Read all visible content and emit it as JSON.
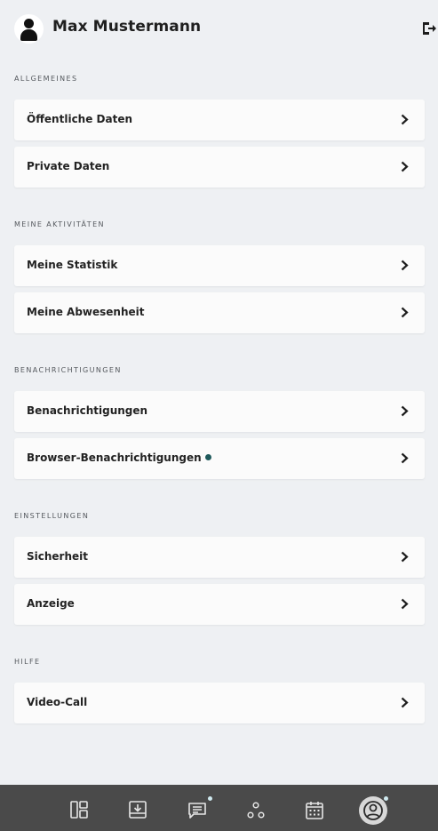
{
  "header": {
    "user_name": "Max Mustermann",
    "avatar_icon": "user-avatar-icon",
    "logout_icon": "logout-icon"
  },
  "sections": [
    {
      "title": "ALLGEMEINES",
      "items": [
        {
          "label": "Öffentliche Daten"
        },
        {
          "label": "Private Daten"
        }
      ]
    },
    {
      "title": "MEINE AKTIVITÄTEN",
      "items": [
        {
          "label": "Meine Statistik"
        },
        {
          "label": "Meine Abwesenheit"
        }
      ]
    },
    {
      "title": "BENACHRICHTIGUNGEN",
      "items": [
        {
          "label": "Benachrichtigungen"
        },
        {
          "label": "Browser-Benachrichtigungen",
          "indicator": true
        }
      ]
    },
    {
      "title": "EINSTELLUNGEN",
      "items": [
        {
          "label": "Sicherheit"
        },
        {
          "label": "Anzeige"
        }
      ]
    },
    {
      "title": "HILFE",
      "items": [
        {
          "label": "Video-Call"
        }
      ]
    }
  ],
  "bottom_nav": {
    "items": [
      {
        "icon": "dashboard-icon"
      },
      {
        "icon": "inbox-download-icon"
      },
      {
        "icon": "chat-icon",
        "badge": true
      },
      {
        "icon": "network-icon"
      },
      {
        "icon": "calendar-icon"
      },
      {
        "icon": "profile-icon",
        "badge": true,
        "active": true
      }
    ]
  },
  "colors": {
    "background": "#eef0f3",
    "card": "#fbfbfb",
    "nav_bar": "#4a4a4a",
    "indicator": "#1f5a5c",
    "badge": "#cfe9ef"
  }
}
